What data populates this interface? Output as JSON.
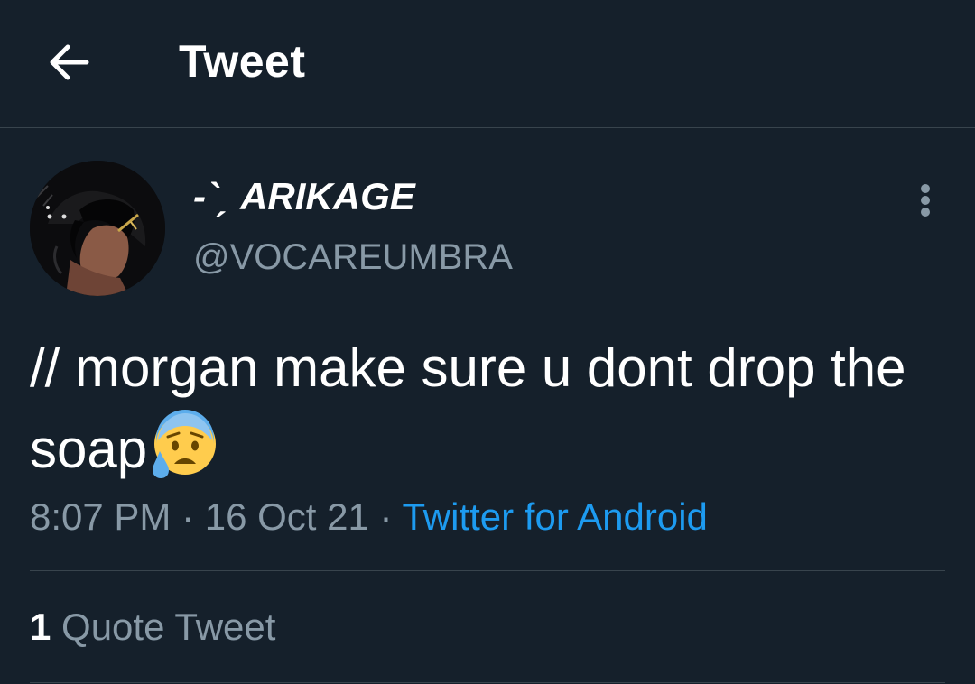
{
  "header": {
    "title": "Tweet",
    "back_icon": "arrow-left-icon"
  },
  "tweet": {
    "author": {
      "display_name": "-ˋˏ ARIKAGE",
      "handle": "@VOCAREUMBRA"
    },
    "text": "// morgan make sure u dont drop the soap",
    "emoji": "anxious-face-with-sweat-icon",
    "time": "8:07 PM",
    "separator": " · ",
    "date": "16 Oct 21",
    "source": "Twitter for Android",
    "quote_tweets": {
      "count": "1",
      "label": "Quote Tweet"
    },
    "more_icon": "more-vertical-icon"
  },
  "colors": {
    "background": "#15202b",
    "secondary_text": "#8899a6",
    "link": "#1d9bf0",
    "divider": "#38444d"
  }
}
